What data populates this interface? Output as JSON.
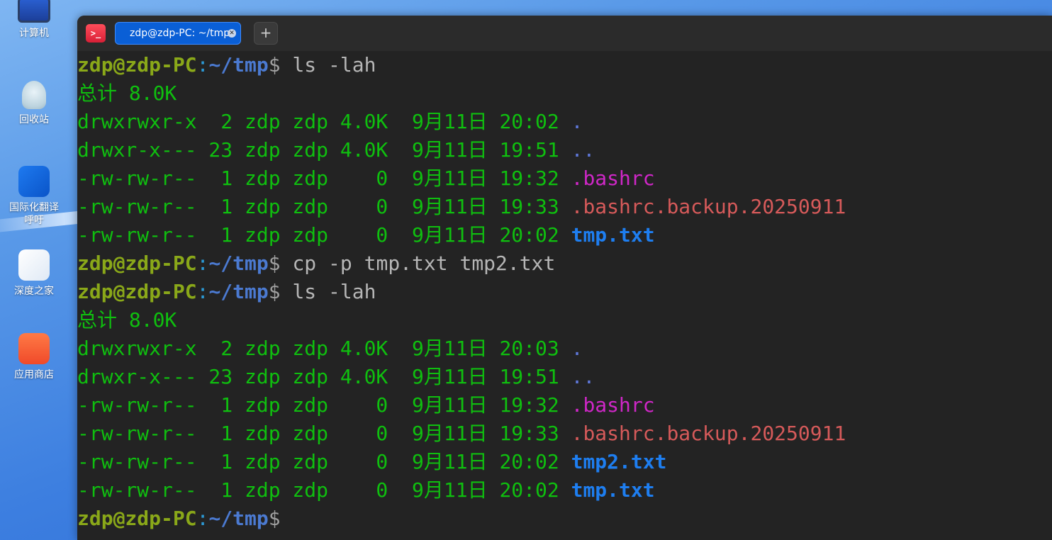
{
  "desktop": {
    "icons": [
      {
        "label": "计算机",
        "icon": "computer-icon"
      },
      {
        "label": "回收站",
        "icon": "trash-icon"
      },
      {
        "label": "国际化翻译\n呼吁",
        "icon": "translate-icon"
      },
      {
        "label": "深度之家",
        "icon": "deepin-home-icon"
      },
      {
        "label": "应用商店",
        "icon": "app-store-icon"
      }
    ]
  },
  "terminal": {
    "tab_title": "zdp@zdp-PC: ~/tmp",
    "new_tab_label": "+",
    "app_icon_glyph": ">_",
    "prompt": {
      "user": "zdp@zdp-PC",
      "colon": ":",
      "path": "~/tmp",
      "dollar": "$ "
    },
    "cmd1": "ls -lah",
    "total1": "总计 8.0K",
    "listing1": [
      {
        "meta": "drwxrwxr-x  2 zdp zdp 4.0K  9月11日 20:02 ",
        "name": "."
      },
      {
        "meta": "drwxr-x--- 23 zdp zdp 4.0K  9月11日 19:51 ",
        "name": ".."
      },
      {
        "meta": "-rw-rw-r--  1 zdp zdp    0  9月11日 19:32 ",
        "name": ".bashrc"
      },
      {
        "meta": "-rw-rw-r--  1 zdp zdp    0  9月11日 19:33 ",
        "name": ".bashrc.backup.20250911"
      },
      {
        "meta": "-rw-rw-r--  1 zdp zdp    0  9月11日 20:02 ",
        "name": "tmp.txt"
      }
    ],
    "cmd2": "cp -p tmp.txt tmp2.txt",
    "cmd3": "ls -lah",
    "total2": "总计 8.0K",
    "listing2": [
      {
        "meta": "drwxrwxr-x  2 zdp zdp 4.0K  9月11日 20:03 ",
        "name": "."
      },
      {
        "meta": "drwxr-x--- 23 zdp zdp 4.0K  9月11日 19:51 ",
        "name": ".."
      },
      {
        "meta": "-rw-rw-r--  1 zdp zdp    0  9月11日 19:32 ",
        "name": ".bashrc"
      },
      {
        "meta": "-rw-rw-r--  1 zdp zdp    0  9月11日 19:33 ",
        "name": ".bashrc.backup.20250911"
      },
      {
        "meta": "-rw-rw-r--  1 zdp zdp    0  9月11日 20:02 ",
        "name": "tmp2.txt"
      },
      {
        "meta": "-rw-rw-r--  1 zdp zdp    0  9月11日 20:02 ",
        "name": "tmp.txt"
      }
    ]
  },
  "colors": {
    "output_green": "#0fbf0f",
    "prompt_user": "#8aa819",
    "prompt_path": "#4b7ad1",
    "directory": "#5e77d8",
    "hidden_file": "#cf27c7",
    "backup_file": "#d65a5a",
    "text_file": "#1e7ef0",
    "tab_active": "#0a5fd6"
  }
}
